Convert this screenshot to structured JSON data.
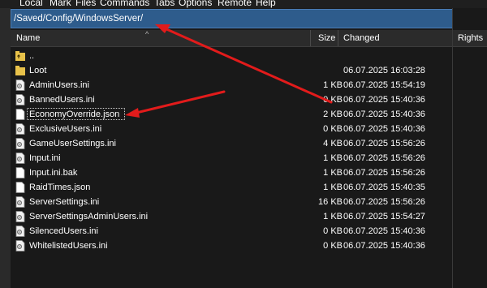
{
  "menu": [
    "Local",
    "Mark",
    "Files",
    "Commands",
    "Tabs",
    "Options",
    "Remote",
    "Help"
  ],
  "path": "/Saved/Config/WindowsServer/",
  "columns": {
    "name": "Name",
    "size": "Size",
    "changed": "Changed",
    "rights": "Rights"
  },
  "sort_indicator": "^",
  "files": [
    {
      "name": "..",
      "size": "",
      "changed": "",
      "type": "parent-folder"
    },
    {
      "name": "Loot",
      "size": "",
      "changed": "06.07.2025 16:03:28",
      "type": "folder"
    },
    {
      "name": "AdminUsers.ini",
      "size": "1 KB",
      "changed": "06.07.2025 15:54:19",
      "type": "config-file"
    },
    {
      "name": "BannedUsers.ini",
      "size": "0 KB",
      "changed": "06.07.2025 15:40:36",
      "type": "config-file"
    },
    {
      "name": "EconomyOverride.json",
      "size": "2 KB",
      "changed": "06.07.2025 15:40:36",
      "type": "file"
    },
    {
      "name": "ExclusiveUsers.ini",
      "size": "0 KB",
      "changed": "06.07.2025 15:40:36",
      "type": "config-file"
    },
    {
      "name": "GameUserSettings.ini",
      "size": "4 KB",
      "changed": "06.07.2025 15:56:26",
      "type": "config-file"
    },
    {
      "name": "Input.ini",
      "size": "1 KB",
      "changed": "06.07.2025 15:56:26",
      "type": "config-file"
    },
    {
      "name": "Input.ini.bak",
      "size": "1 KB",
      "changed": "06.07.2025 15:56:26",
      "type": "file"
    },
    {
      "name": "RaidTimes.json",
      "size": "1 KB",
      "changed": "06.07.2025 15:40:35",
      "type": "file"
    },
    {
      "name": "ServerSettings.ini",
      "size": "16 KB",
      "changed": "06.07.2025 15:56:26",
      "type": "config-file"
    },
    {
      "name": "ServerSettingsAdminUsers.ini",
      "size": "1 KB",
      "changed": "06.07.2025 15:54:27",
      "type": "config-file"
    },
    {
      "name": "SilencedUsers.ini",
      "size": "0 KB",
      "changed": "06.07.2025 15:40:36",
      "type": "config-file"
    },
    {
      "name": "WhitelistedUsers.ini",
      "size": "0 KB",
      "changed": "06.07.2025 15:40:36",
      "type": "config-file"
    }
  ],
  "colors": {
    "background": "#191919",
    "path_bar": "#2e5c8c",
    "header": "#2b2b2b",
    "folder": "#e8c24a",
    "annotation_arrow": "#e21b1b"
  }
}
